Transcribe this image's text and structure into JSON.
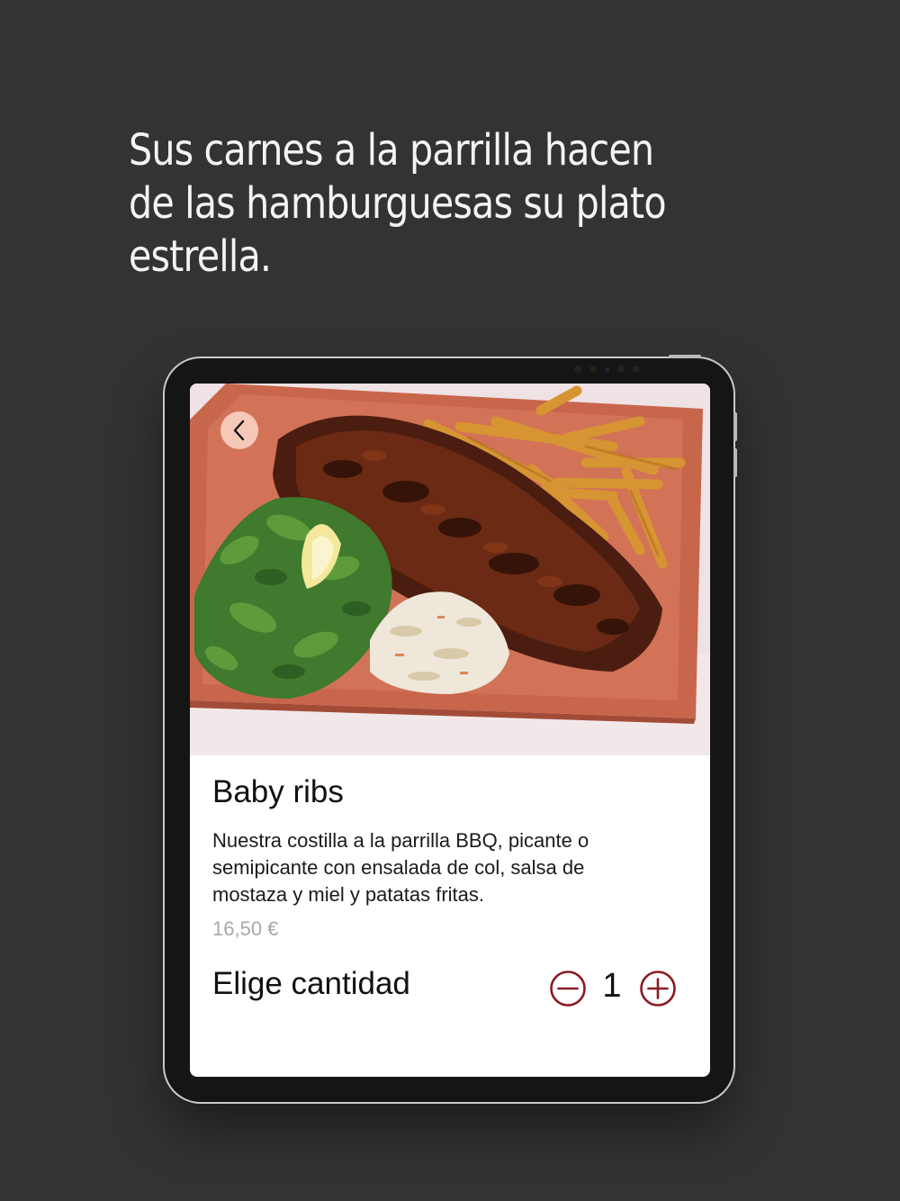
{
  "headline": "Sus carnes a la parrilla hacen de las hamburguesas su plato estrella.",
  "product": {
    "image": "baby-ribs-plate-photo",
    "title": "Baby ribs",
    "description": "Nuestra costilla a la parrilla BBQ, picante o semipicante con ensalada de col, salsa de mostaza y miel y patatas fritas.",
    "price": "16,50 €"
  },
  "quantity": {
    "label": "Elige cantidad",
    "value": "1",
    "decrease_icon": "minus-circle-icon",
    "increase_icon": "plus-circle-icon"
  },
  "navigation": {
    "back_icon": "chevron-left-icon"
  },
  "colors": {
    "background": "#333333",
    "accent": "#8b1a22",
    "price": "#a8a8a8",
    "plate": "#c8664c"
  }
}
